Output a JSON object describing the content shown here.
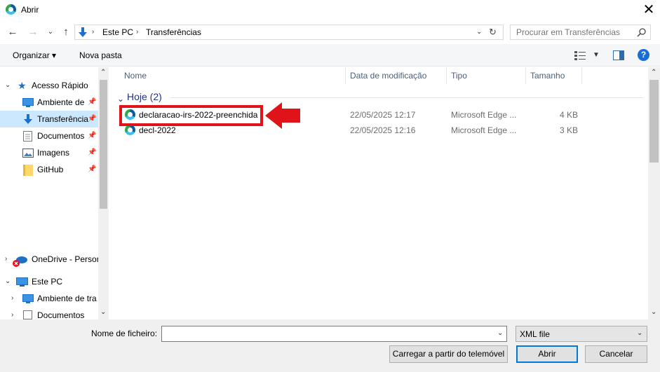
{
  "window": {
    "title": "Abrir",
    "close_symbol": "✕"
  },
  "nav": {
    "path": [
      "Este PC",
      "Transferências"
    ],
    "search_placeholder": "Procurar em Transferências"
  },
  "toolbar": {
    "organize": "Organizar ▾",
    "new_folder": "Nova pasta",
    "help": "?"
  },
  "sidebar": {
    "quick_access": "Acesso Rápido",
    "items": [
      {
        "label": "Ambiente de",
        "pinned": true
      },
      {
        "label": "Transferência",
        "pinned": true
      },
      {
        "label": "Documentos",
        "pinned": true
      },
      {
        "label": "Imagens",
        "pinned": true
      },
      {
        "label": "GitHub",
        "pinned": true
      }
    ],
    "onedrive": "OneDrive - Persor",
    "this_pc": "Este PC",
    "pc_items": [
      "Ambiente de tra",
      "Documentos"
    ]
  },
  "columns": {
    "name": "Nome",
    "modified": "Data de modificação",
    "type": "Tipo",
    "size": "Tamanho"
  },
  "group": {
    "label": "Hoje (2)"
  },
  "files": [
    {
      "name": "declaracao-irs-2022-preenchida",
      "modified": "22/05/2025 12:17",
      "type": "Microsoft Edge ...",
      "size": "4 KB"
    },
    {
      "name": "decl-2022",
      "modified": "22/05/2025 12:16",
      "type": "Microsoft Edge ...",
      "size": "3 KB"
    }
  ],
  "footer": {
    "filename_label": "Nome de ficheiro:",
    "filename_value": "",
    "file_type": "XML file",
    "load_phone_button": "Carregar a partir do telemóvel",
    "open_button": "Abrir",
    "cancel_button": "Cancelar"
  },
  "colors": {
    "annotation_red": "#e01418",
    "selection_blue": "#cce8ff",
    "accent": "#0078d7"
  }
}
